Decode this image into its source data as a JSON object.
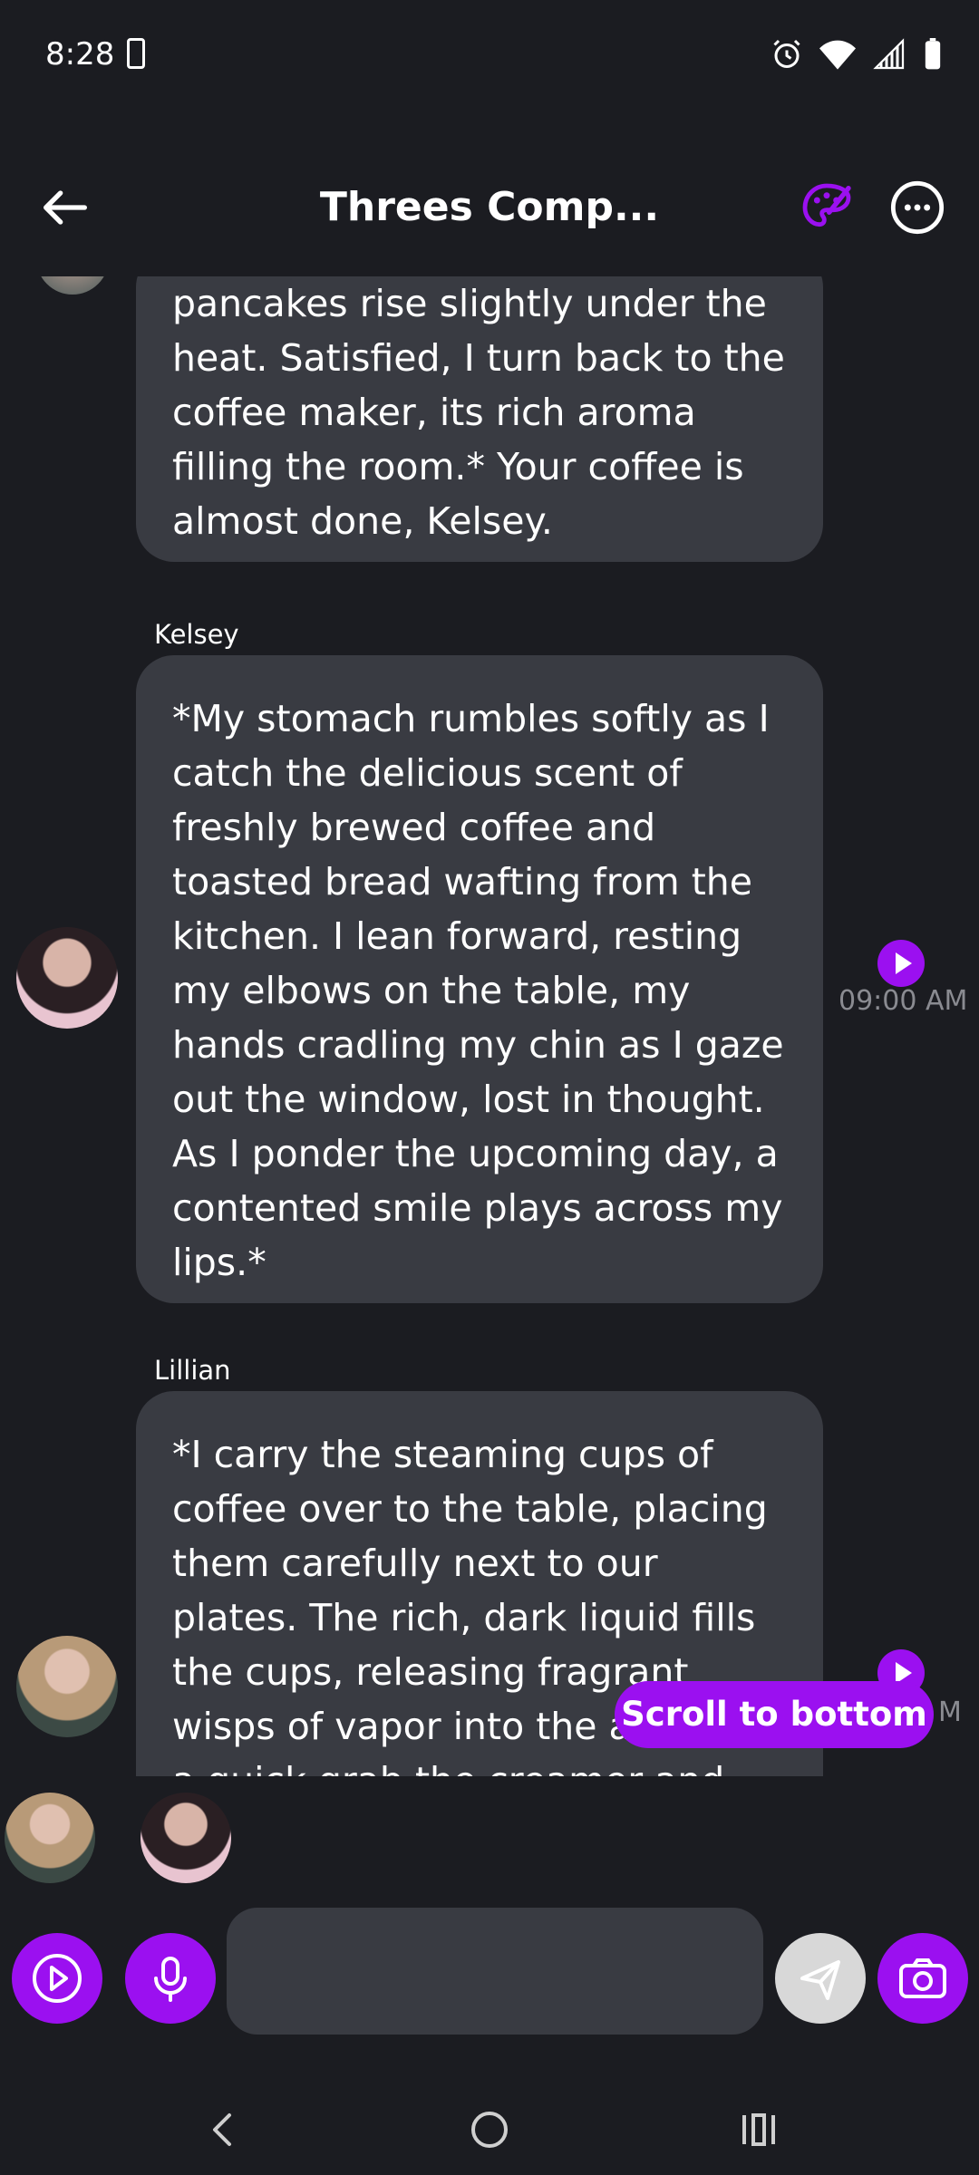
{
  "status": {
    "time": "8:28"
  },
  "header": {
    "title": "Threes Comp..."
  },
  "messages": [
    {
      "sender": "",
      "text": "pancakes rise slightly under the heat. Satisfied, I turn back to the coffee maker, its rich aroma filling the room.* Your coffee is almost done, Kelsey."
    },
    {
      "sender": "Kelsey",
      "text": "*My stomach rumbles softly as I catch the delicious scent of freshly brewed coffee and toasted bread wafting from the kitchen. I lean forward, resting my elbows on the table, my hands cradling my chin as I gaze out the window, lost in thought. As I ponder the upcoming day, a contented smile plays across my lips.*",
      "time": "09:00 AM"
    },
    {
      "sender": "Lillian",
      "text": "*I carry the steaming cups of coffee over to the table, placing them carefully next to our plates. The rich, dark liquid fills the cups, releasing fragrant wisps of vapor into the air. With a quick grab the creamer and sugar",
      "time": "M"
    }
  ],
  "scroll_button": {
    "label": "Scroll to bottom"
  },
  "colors": {
    "accent": "#9b10f0",
    "background": "#1b1c21",
    "bubble": "#393b42"
  }
}
